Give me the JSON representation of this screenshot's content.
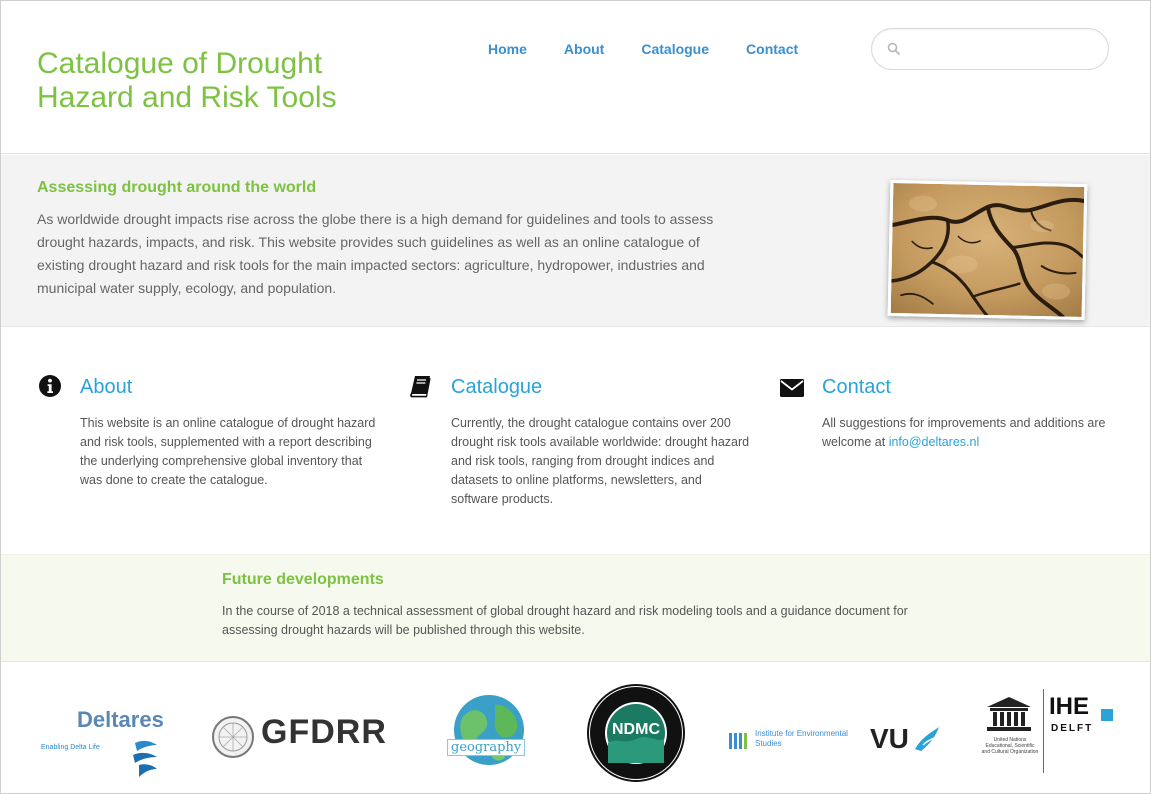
{
  "header": {
    "site_title": "Catalogue of Drought Hazard and Risk Tools",
    "nav": [
      "Home",
      "About",
      "Catalogue",
      "Contact"
    ],
    "search": {
      "value": "",
      "placeholder": ""
    }
  },
  "hero": {
    "heading": "Assessing drought around the world",
    "body": "As worldwide drought impacts rise across the globe there is a high demand for guidelines and tools to assess drought hazards, impacts, and risk. This website provides such guidelines as well as an online catalogue of existing drought hazard and risk tools for the main impacted sectors: agriculture, hydropower, industries and municipal water supply, ecology, and population.",
    "image_icon": "cracked-earth-photo"
  },
  "features": {
    "about": {
      "icon": "info-circle-icon",
      "title": "About",
      "body": "This website is an online catalogue of drought hazard and risk tools, supplemented with a report describing the underlying comprehensive global inventory that was done to create the catalogue."
    },
    "catalogue": {
      "icon": "book-icon",
      "title": "Catalogue",
      "body": "Currently, the drought catalogue contains over 200 drought risk tools available worldwide: drought hazard and risk tools, ranging from drought indices and datasets to online platforms, newsletters, and software products."
    },
    "contact": {
      "icon": "envelope-icon",
      "title": "Contact",
      "body_prefix": "All suggestions for improvements and additions are welcome at ",
      "email": "info@deltares.nl"
    }
  },
  "future": {
    "heading": "Future developments",
    "body": "In the course of 2018 a technical assessment of global drought hazard and risk modeling tools and a guidance document for assessing drought hazards will be published through this website."
  },
  "partners": {
    "deltares": {
      "name": "Deltares",
      "tagline": "Enabling Delta Life"
    },
    "gfdrr": {
      "name": "GFDRR"
    },
    "geography": {
      "name": "geography"
    },
    "ndmc": {
      "name": "NDMC"
    },
    "ivm": {
      "name": "Institute for Environmental Studies"
    },
    "vu": {
      "name": "VU"
    },
    "unesco": {
      "name": "United Nations Educational, Scientific and Cultural Organization"
    },
    "ihe": {
      "name": "IHE",
      "sub": "DELFT"
    }
  },
  "colors": {
    "green": "#7dc242",
    "blue_link": "#3a8fd0",
    "feature_title": "#2aa3d8"
  }
}
